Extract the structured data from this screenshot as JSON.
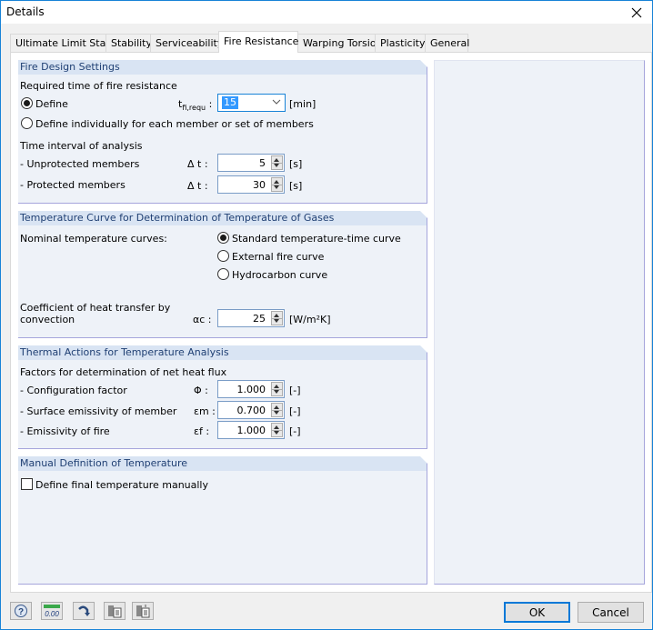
{
  "window": {
    "title": "Details"
  },
  "tabs": [
    {
      "label": "Ultimate Limit State",
      "active": false
    },
    {
      "label": "Stability",
      "active": false
    },
    {
      "label": "Serviceability",
      "active": false
    },
    {
      "label": "Fire Resistance",
      "active": true
    },
    {
      "label": "Warping Torsion",
      "active": false
    },
    {
      "label": "Plasticity",
      "active": false
    },
    {
      "label": "General",
      "active": false
    }
  ],
  "fire_design": {
    "header": "Fire Design Settings",
    "required_time_label": "Required time of fire resistance",
    "define_label": "Define",
    "define_checked": true,
    "t_symbol": "t",
    "t_sub": "fi,requ",
    "t_colon": ":",
    "t_value": "15",
    "t_unit": "[min]",
    "individually_label": "Define individually for each member or set of members",
    "individually_checked": false,
    "interval_label": "Time interval of analysis",
    "unprotected_label": "- Unprotected members",
    "unprotected_symbol": "Δ t :",
    "unprotected_value": "5",
    "unprotected_unit": "[s]",
    "protected_label": "- Protected members",
    "protected_symbol": "Δ t :",
    "protected_value": "30",
    "protected_unit": "[s]"
  },
  "temperature_curve": {
    "header": "Temperature Curve for Determination of Temperature of Gases",
    "nominal_label": "Nominal temperature curves:",
    "options": [
      {
        "label": "Standard temperature-time curve",
        "checked": true
      },
      {
        "label": "External fire curve",
        "checked": false
      },
      {
        "label": "Hydrocarbon curve",
        "checked": false
      }
    ],
    "coef_label_1": "Coefficient of heat transfer by",
    "coef_label_2": "convection",
    "coef_symbol": "αc :",
    "coef_value": "25",
    "coef_unit": "[W/m²K]"
  },
  "thermal_actions": {
    "header": "Thermal Actions for Temperature Analysis",
    "factors_label": "Factors for determination of net heat flux",
    "rows": [
      {
        "label": "- Configuration factor",
        "symbol": "Φ :",
        "value": "1.000",
        "unit": "[-]"
      },
      {
        "label": "- Surface emissivity of member",
        "symbol": "εm :",
        "value": "0.700",
        "unit": "[-]"
      },
      {
        "label": "- Emissivity of fire",
        "symbol": "εf :",
        "value": "1.000",
        "unit": "[-]"
      }
    ]
  },
  "manual_temp": {
    "header": "Manual Definition of Temperature",
    "checkbox_label": "Define final temperature manually",
    "checked": false
  },
  "footer": {
    "icons": [
      "help-icon",
      "units-icon",
      "redo-icon",
      "export-icon",
      "import-icon"
    ],
    "units_text": "0.00",
    "ok_label": "OK",
    "cancel_label": "Cancel"
  }
}
